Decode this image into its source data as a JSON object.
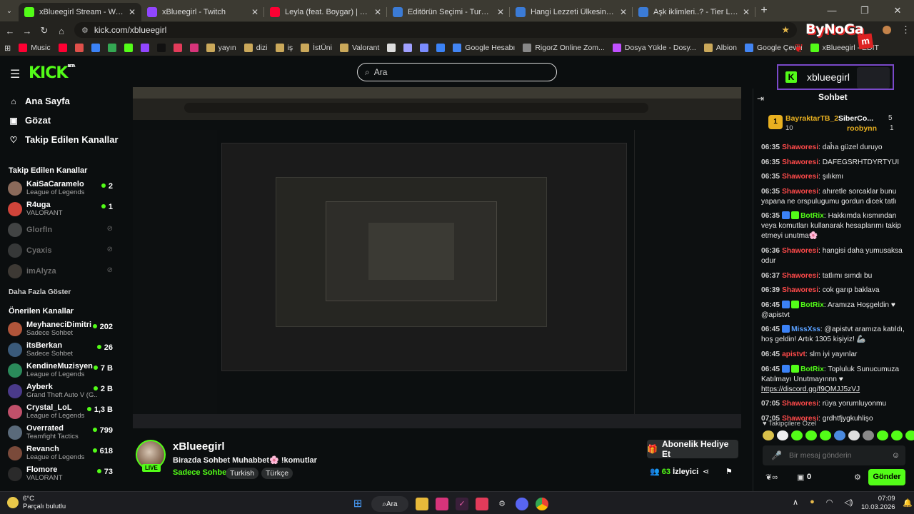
{
  "browser": {
    "tabs": [
      {
        "title": "xBlueegirl Stream - Watch Live",
        "active": true,
        "color": "#53fc18"
      },
      {
        "title": "xBlueegirl - Twitch",
        "active": false,
        "color": "#9146ff"
      },
      {
        "title": "Leyla (feat. Boygar) | YouTub",
        "active": false,
        "color": "#ff0033"
      },
      {
        "title": "Editörün Seçimi - Turnuva - Qu",
        "active": false,
        "color": "#3b7bd6"
      },
      {
        "title": "Hangi Lezzeti Ülkesinde Denem",
        "active": false,
        "color": "#3b7bd6"
      },
      {
        "title": "Aşk iklimleri..? - Tier List | Kör",
        "active": false,
        "color": "#3b7bd6"
      }
    ],
    "new_tab": "+",
    "url": "kick.com/xblueegirl",
    "bookmarks": [
      {
        "label": "Music",
        "color": "#ff0033"
      },
      {
        "label": "",
        "color": "#ff0033"
      },
      {
        "label": "",
        "color": "#e0504a"
      },
      {
        "label": "",
        "color": "#3b82f6"
      },
      {
        "label": "",
        "color": "#34a853"
      },
      {
        "label": "",
        "color": "#53fc18"
      },
      {
        "label": "",
        "color": "#9146ff"
      },
      {
        "label": "",
        "color": "#111111"
      },
      {
        "label": "",
        "color": "#e23b5a"
      },
      {
        "label": "",
        "color": "#d6347a"
      },
      {
        "label": "yayın",
        "color": "#caa85a"
      },
      {
        "label": "dizi",
        "color": "#caa85a"
      },
      {
        "label": "iş",
        "color": "#caa85a"
      },
      {
        "label": "İstÜni",
        "color": "#caa85a"
      },
      {
        "label": "Valorant",
        "color": "#caa85a"
      },
      {
        "label": "",
        "color": "#dddddd"
      },
      {
        "label": "",
        "color": "#a0a0ff"
      },
      {
        "label": "",
        "color": "#7a8cff"
      },
      {
        "label": "",
        "color": "#3b82f6"
      },
      {
        "label": "Google Hesabı",
        "color": "#4285f4"
      },
      {
        "label": "RigorZ Online Zom...",
        "color": "#888888"
      },
      {
        "label": "Dosya Yükle - Dosy...",
        "color": "#c050ff"
      },
      {
        "label": "Albion",
        "color": "#caa85a"
      },
      {
        "label": "Google Çeviri",
        "color": "#4285f4"
      },
      {
        "label": "xBlueegirl - EDIT",
        "color": "#53fc18"
      }
    ],
    "brand_text": "ByNoGa",
    "brand_m": "m"
  },
  "kick": {
    "logo": "KICK",
    "logo_sup": "BETA",
    "search_placeholder": "Ara"
  },
  "sidebar": {
    "nav": [
      {
        "label": "Ana Sayfa",
        "icon": "⌂"
      },
      {
        "label": "Gözat",
        "icon": "▣"
      },
      {
        "label": "Takip Edilen Kanallar",
        "icon": "♡"
      }
    ],
    "followed_title": "Takip Edilen Kanallar",
    "followed": [
      {
        "name": "KaiSaCaramelo",
        "sub": "League of Legends",
        "viewers": "2",
        "online": true,
        "color": "#8a6a5a"
      },
      {
        "name": "R4uga",
        "sub": "VALORANT",
        "viewers": "1",
        "online": true,
        "color": "#d0443a"
      },
      {
        "name": "GlorfIn",
        "sub": "",
        "viewers": "",
        "online": false,
        "color": "#aaaaaa"
      },
      {
        "name": "Cyaxis",
        "sub": "",
        "viewers": "",
        "online": false,
        "color": "#888888"
      },
      {
        "name": "imAlyza",
        "sub": "",
        "viewers": "",
        "online": false,
        "color": "#9a8a7a"
      }
    ],
    "show_more": "Daha Fazla Göster",
    "recommended_title": "Önerilen Kanallar",
    "recommended": [
      {
        "name": "MeyhaneciDimitri",
        "sub": "Sadece Sohbet",
        "viewers": "202",
        "color": "#b0553a"
      },
      {
        "name": "itsBerkan",
        "sub": "Sadece Sohbet",
        "viewers": "26",
        "color": "#3a5a7a"
      },
      {
        "name": "KendineMuzisyen",
        "sub": "League of Legends",
        "viewers": "7 B",
        "color": "#2a8a5a"
      },
      {
        "name": "Ayberk",
        "sub": "Grand Theft Auto V (G...",
        "viewers": "2 B",
        "color": "#4a3a8a"
      },
      {
        "name": "Crystal_LoL",
        "sub": "League of Legends",
        "viewers": "1,3 B",
        "color": "#c0506a"
      },
      {
        "name": "Overrated",
        "sub": "Teamfight Tactics",
        "viewers": "799",
        "color": "#5a6a7a"
      },
      {
        "name": "Revanch",
        "sub": "League of Legends",
        "viewers": "618",
        "color": "#7a4a3a"
      },
      {
        "name": "Flomore",
        "sub": "VALORANT",
        "viewers": "73",
        "color": "#2a2a2a"
      }
    ]
  },
  "stream_info": {
    "channel": "xBlueegirl",
    "live": "LIVE",
    "title": "Birazda Sohbet Muhabbet",
    "title_suffix": " !komutlar",
    "category": "Sadece Sohbet",
    "tags": [
      "Turkish",
      "Türkçe"
    ],
    "sub_button": "Abonelik Hediye Et",
    "viewers": "63",
    "viewers_label": "İzleyici"
  },
  "chat": {
    "streamer": "xblueegirl",
    "title": "Sohbet",
    "top_gifter": {
      "rank": "1",
      "name": "BayraktarTB_2",
      "value": "10",
      "second": "SiberCo...",
      "second_count": "5",
      "third": "roobynn",
      "third_count": "1"
    },
    "messages": [
      {
        "time": "06:35",
        "user": "Shaworesi",
        "color": "#ff4a4a",
        "badges": [],
        "text": "daha güzel duruyo"
      },
      {
        "time": "06:35",
        "user": "Shaworesi",
        "color": "#ff4a4a",
        "badges": [],
        "text": "DAFEGSRHTDYRTYUI"
      },
      {
        "time": "06:35",
        "user": "Shaworesi",
        "color": "#ff4a4a",
        "badges": [],
        "text": "şılıkmı"
      },
      {
        "time": "06:35",
        "user": "Shaworesi",
        "color": "#ff4a4a",
        "badges": [],
        "text": "ahıretle sorcaklar bunu yapana ne orspulugumu gordun dicek tatlı"
      },
      {
        "time": "06:35",
        "user": "BotRix",
        "color": "#53fc18",
        "badges": [
          "#3b82f6",
          "#53fc18"
        ],
        "text": "Hakkımda kısmından veya komutları kullanarak hesaplarımı takip etmeyi unutma🌸"
      },
      {
        "time": "06:36",
        "user": "Shaworesi",
        "color": "#ff4a4a",
        "badges": [],
        "text": "hangisi daha yumusaksa odur"
      },
      {
        "time": "06:37",
        "user": "Shaworesi",
        "color": "#ff4a4a",
        "badges": [],
        "text": "tatlımı sımdı bu"
      },
      {
        "time": "06:39",
        "user": "Shaworesi",
        "color": "#ff4a4a",
        "badges": [],
        "text": "cok garıp baklava"
      },
      {
        "time": "06:45",
        "user": "BotRix",
        "color": "#53fc18",
        "badges": [
          "#3b82f6",
          "#53fc18"
        ],
        "text": "Aramıza Hoşgeldin ♥ @apistvt"
      },
      {
        "time": "06:45",
        "user": "MissXss",
        "color": "#5aa0ff",
        "badges": [
          "#3b82f6"
        ],
        "text": "@apistvt aramıza katıldı, hoş geldin! Artık 1305 kişiyiz! 🦾"
      },
      {
        "time": "06:45",
        "user": "apistvt",
        "color": "#ff4a4a",
        "badges": [],
        "text": "slm iyi yayınlar"
      },
      {
        "time": "06:45",
        "user": "BotRix",
        "color": "#53fc18",
        "badges": [
          "#3b82f6",
          "#53fc18"
        ],
        "text": "Topluluk Sunucumuza Katılmayı Unutmayınnn ♥",
        "link": "https://discord.gg/f9QMJJ5zVJ"
      },
      {
        "time": "07:05",
        "user": "Shaworesi",
        "color": "#ff4a4a",
        "badges": [],
        "text": "rüya yorumluyonmu"
      },
      {
        "time": "07:05",
        "user": "Shaworesi",
        "color": "#ff4a4a",
        "badges": [],
        "text": "grdhtfjygkuhlişo"
      }
    ],
    "subs_only": "Takipçilere Özel",
    "input_placeholder": "Bir mesaj gönderin",
    "points": "0",
    "send": "Gönder"
  },
  "taskbar": {
    "temp": "6°C",
    "weather": "Parçalı bulutlu",
    "search": "Ara",
    "time": "07:09",
    "date": "10.03.2026"
  }
}
